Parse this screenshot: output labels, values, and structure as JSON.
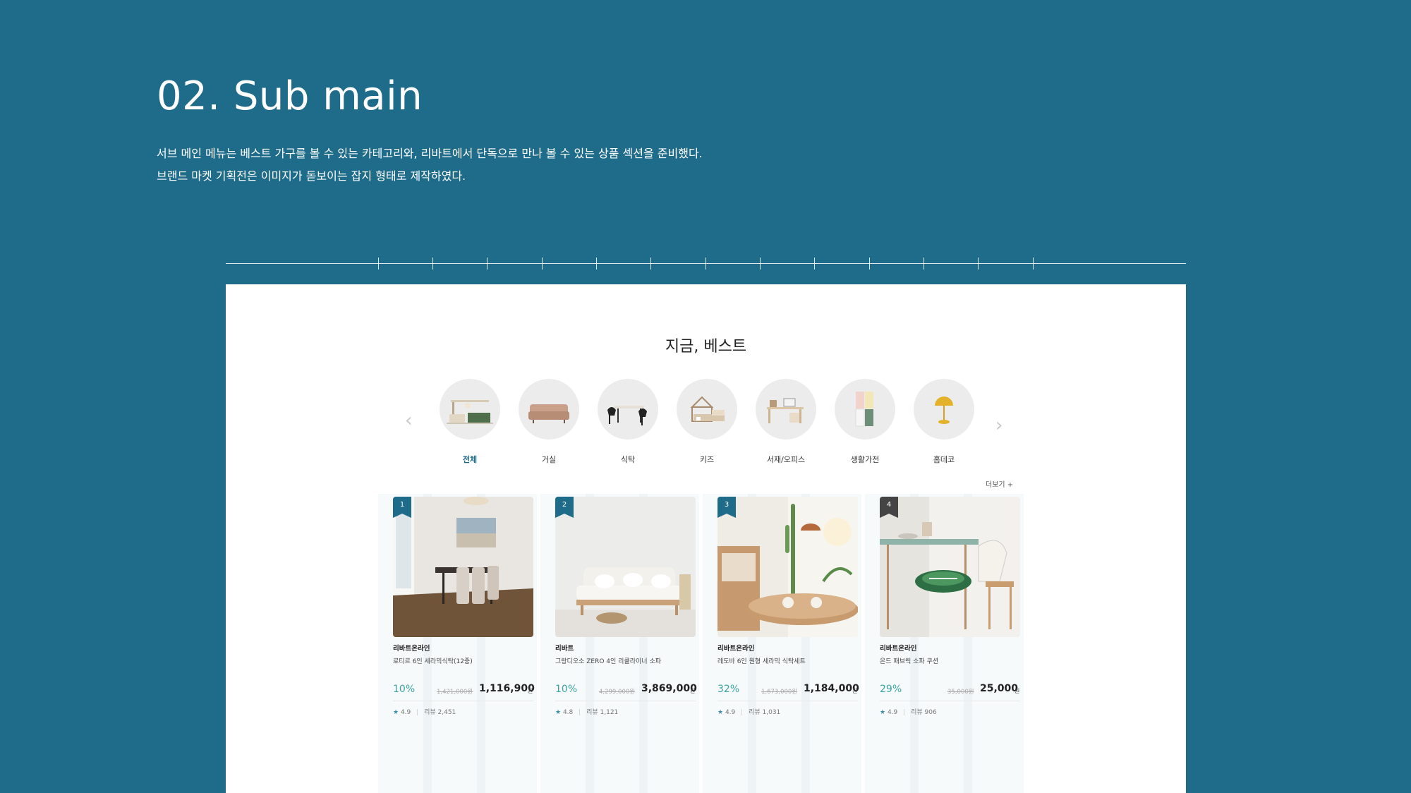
{
  "hero": {
    "title": "02. Sub main",
    "desc_line1": "서브 메인 메뉴는 베스트 가구를 볼 수 있는 카테고리와, 리바트에서 단독으로 만나 볼 수 있는 상품 섹션을 준비했다.",
    "desc_line2": "브랜드 마켓 기획전은 이미지가 돋보이는 잡지 형태로 제작하였다."
  },
  "section": {
    "title": "지금, 베스트",
    "more": "더보기 +",
    "prev_arrow": "‹",
    "next_arrow": "›"
  },
  "categories": [
    {
      "label": "전체",
      "icon": "living-set-icon",
      "active": true
    },
    {
      "label": "거실",
      "icon": "sofa-icon"
    },
    {
      "label": "식탁",
      "icon": "dining-table-icon"
    },
    {
      "label": "키즈",
      "icon": "kids-bed-icon"
    },
    {
      "label": "서재/오피스",
      "icon": "desk-icon"
    },
    {
      "label": "생활가전",
      "icon": "refrigerator-icon"
    },
    {
      "label": "홈데코",
      "icon": "lamp-icon"
    }
  ],
  "products": [
    {
      "rank": "1",
      "brand": "리바트온라인",
      "name": "로티르 6인 세라믹식탁(12중)",
      "discount": "10%",
      "original": "1,421,000원",
      "price": "1,116,900",
      "unit": "원",
      "rating": "4.9",
      "review_label": "리뷰",
      "reviews": "2,451"
    },
    {
      "rank": "2",
      "brand": "리바트",
      "name": "그랑디오소 ZERO 4인 리클라이너 소파",
      "discount": "10%",
      "original": "4,299,000원",
      "price": "3,869,000",
      "unit": "원",
      "rating": "4.8",
      "review_label": "리뷰",
      "reviews": "1,121"
    },
    {
      "rank": "3",
      "brand": "리바트온라인",
      "name": "레도바 6인 원형 세라믹 식탁세트",
      "discount": "32%",
      "original": "1,673,000원",
      "price": "1,184,000",
      "unit": "원",
      "rating": "4.9",
      "review_label": "리뷰",
      "reviews": "1,031"
    },
    {
      "rank": "4",
      "brand": "리바트온라인",
      "name": "온드 패브릭 소파 쿠션",
      "discount": "29%",
      "original": "35,000원",
      "price": "25,000",
      "unit": "원",
      "rating": "4.9",
      "review_label": "리뷰",
      "reviews": "906"
    }
  ],
  "colors": {
    "background": "#1e6b8a",
    "accent_discount": "#3aa5a0",
    "badge": "#1e6b8a"
  }
}
